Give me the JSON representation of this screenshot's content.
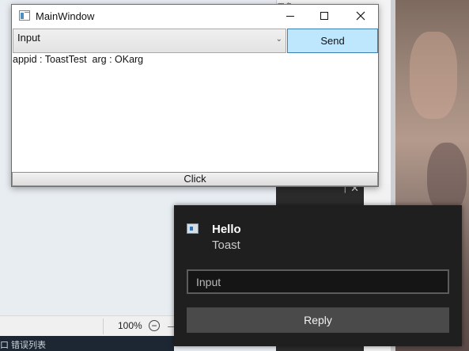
{
  "main_window": {
    "title": "MainWindow",
    "input_combo_value": "Input",
    "send_label": "Send",
    "output_line": "appid : ToastTest  arg : OKarg",
    "click_label": "Click"
  },
  "background": {
    "zoom_level": "100%",
    "zoom_minus": "−",
    "snippet_text": "用多",
    "taskbar_text": "口  错误列表"
  },
  "toast": {
    "title": "Hello",
    "body": "Toast",
    "input_placeholder": "Input",
    "reply_label": "Reply"
  },
  "colors": {
    "send_button": "#bee6fd",
    "toast_background": "#1f1f1f",
    "reply_button": "#4a4a4a"
  },
  "icons": {
    "app": "window-app-icon",
    "toast_app": "toast-app-icon",
    "minimize": "minimize-icon",
    "maximize": "maximize-icon",
    "close": "close-icon",
    "dropdown": "chevron-down-icon"
  }
}
